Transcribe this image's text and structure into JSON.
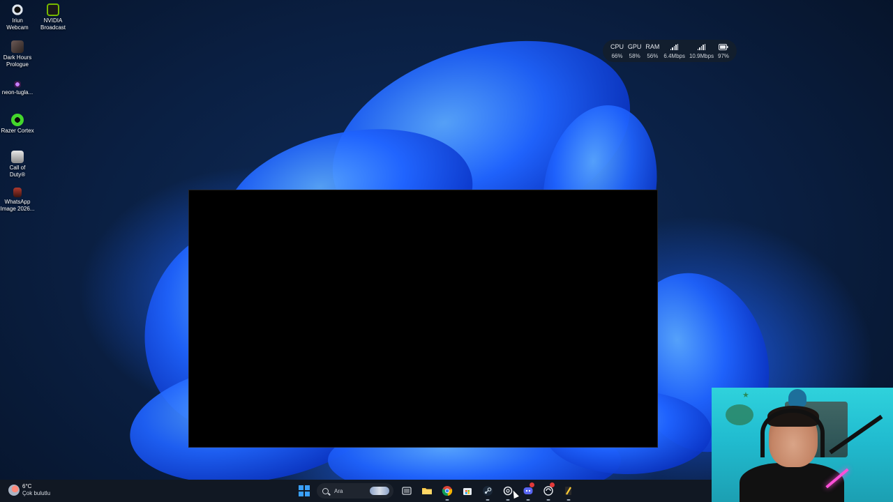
{
  "desktop": {
    "icons": [
      {
        "label": "Iriun\nWebcam",
        "icon": "webcam-app-icon",
        "color": "#dfe6ee"
      },
      {
        "label": "NVIDIA\nBroadcast",
        "icon": "nvidia-icon",
        "color": "#76b900"
      },
      {
        "label": "Dark Hours\nPrologue",
        "icon": "game-icon",
        "color": "#6c5a57"
      },
      {
        "label": "neon-tugla...",
        "icon": "image-file-icon",
        "color": "#9b59b6"
      },
      {
        "label": "Razer Cortex",
        "icon": "razer-cortex-icon",
        "color": "#44d62c"
      },
      {
        "label": "Call of\nDuty®",
        "icon": "call-of-duty-icon",
        "color": "#e8e8e8"
      },
      {
        "label": "WhatsApp\nImage 2026...",
        "icon": "image-file-icon",
        "color": "#b03a2e"
      }
    ]
  },
  "system_widget": {
    "columns": [
      {
        "label": "CPU",
        "value": "66%"
      },
      {
        "label": "GPU",
        "value": "58%"
      },
      {
        "label": "RAM",
        "value": "56%"
      },
      {
        "label": "upload-signal-icon",
        "value": "6.4Mbps"
      },
      {
        "label": "download-signal-icon",
        "value": "10.9Mbps"
      },
      {
        "label": "battery-icon",
        "value": "97%"
      }
    ]
  },
  "taskbar": {
    "weather": {
      "temperature": "6°C",
      "condition": "Çok bulutlu"
    },
    "search": {
      "placeholder": "Ara"
    },
    "apps": [
      {
        "name": "file-manager-app",
        "icon": "file-folder-icon",
        "running": false
      },
      {
        "name": "chrome-app",
        "icon": "chrome-icon",
        "running": true
      },
      {
        "name": "store-app",
        "icon": "microsoft-store-icon",
        "running": false
      },
      {
        "name": "steam-app",
        "icon": "steam-icon",
        "running": true
      },
      {
        "name": "chatgpt-app",
        "icon": "openai-icon",
        "running": true
      },
      {
        "name": "discord-app",
        "icon": "discord-icon",
        "running": true
      },
      {
        "name": "nvidia-app",
        "icon": "nvidia-app-icon",
        "running": true
      },
      {
        "name": "pencil-app",
        "icon": "pencil-icon",
        "running": true
      }
    ]
  }
}
